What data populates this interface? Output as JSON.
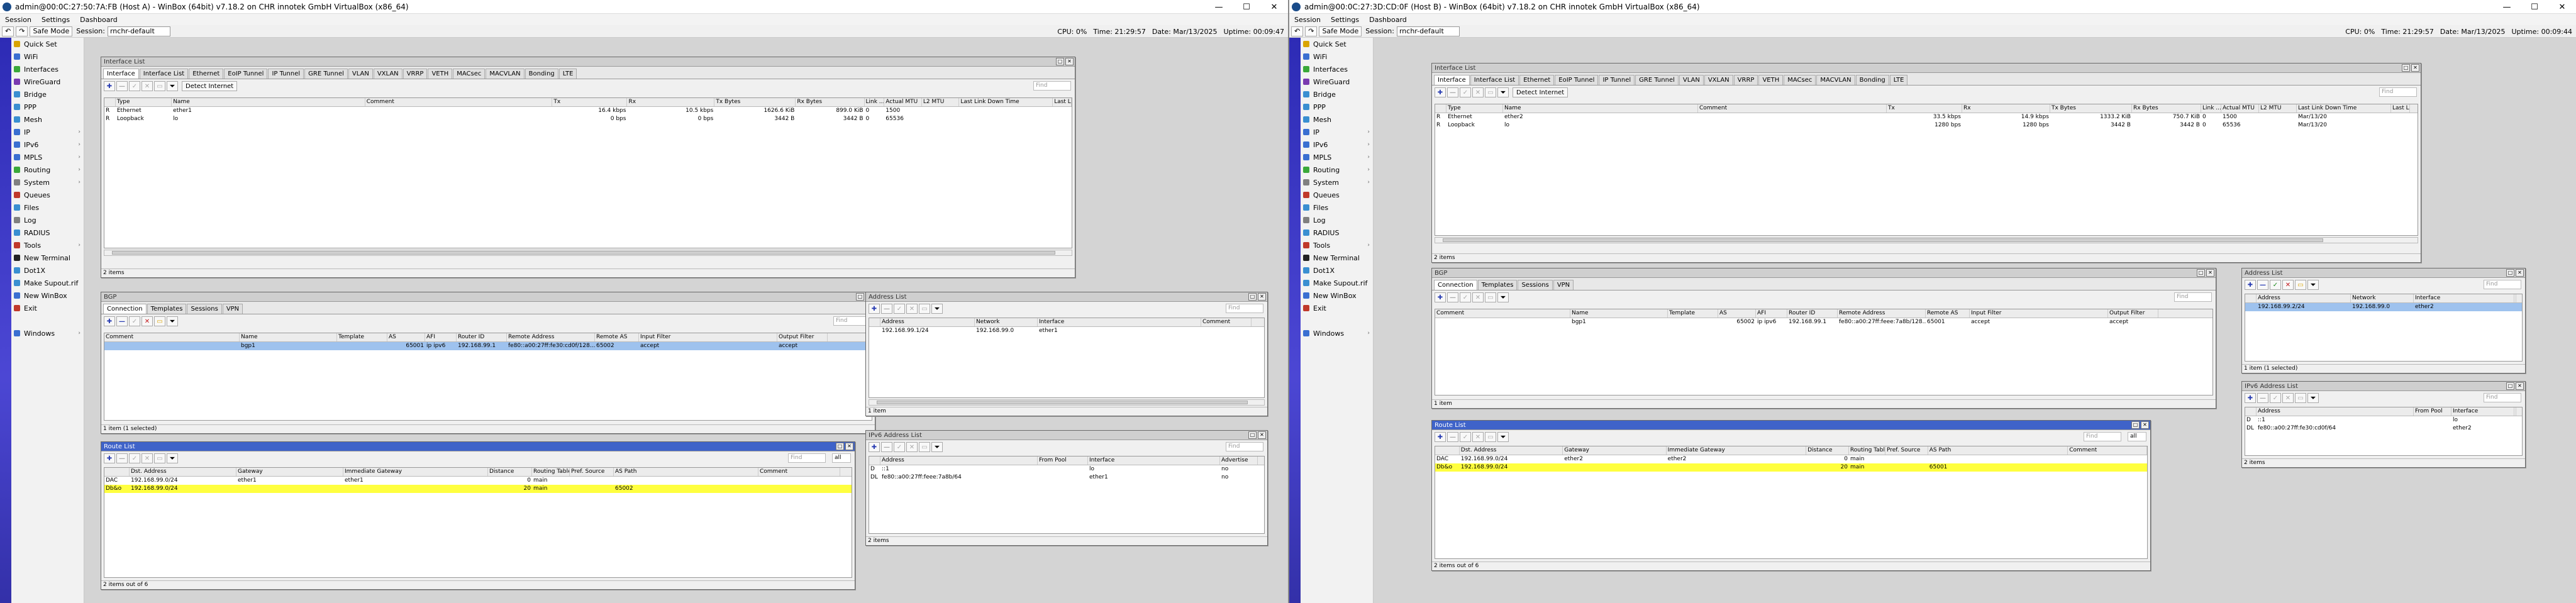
{
  "left": {
    "title": "admin@00:0C:27:50:7A:FB (Host A) - WinBox (64bit) v7.18.2 on CHR innotek GmbH VirtualBox (x86_64)",
    "uptime": "Uptime: 00:09:47",
    "time": "Time: 21:29:57",
    "date": "Date: Mar/13/2025",
    "interfaces": [
      {
        "flag": "R",
        "type": "Ethernet",
        "name": "ether1",
        "comment": "",
        "tx": "16.4 kbps",
        "rx": "1626.6 KiB",
        "rx2": "10.5 kbps",
        "txb": "1626.6 KiB",
        "rxb": "899.0 KiB",
        "link": "0",
        "amtu": "1500",
        "l2": "",
        "lldt": ""
      },
      {
        "flag": "R",
        "type": "Loopback",
        "name": "lo",
        "comment": "",
        "tx": "0 bps",
        "rx": "",
        "rx2": "0 bps",
        "txb": "3442 B",
        "rxb": "3442 B",
        "link": "0",
        "amtu": "65536",
        "l2": "",
        "lldt": ""
      }
    ],
    "bgp_rows": [
      {
        "comment": "",
        "name": "bgp1",
        "template": "",
        "as": "65001",
        "afi": "ip ipv6",
        "rid": "192.168.99.1",
        "raddr": "fe80::a00:27ff:fe30:cd0f/128...",
        "ras": "65002",
        "infilter": "accept",
        "outfilter": "accept"
      }
    ],
    "addr_rows": [
      {
        "flag": "",
        "addr": "192.168.99.1/24",
        "net": "192.168.99.0",
        "iface": "ether1"
      }
    ],
    "ipv6_rows": [
      {
        "flag": "D",
        "addr": "::1",
        "pool": "",
        "iface": "lo",
        "adv": "no"
      },
      {
        "flag": "DL",
        "addr": "fe80::a00:27ff:feee:7a8b/64",
        "pool": "",
        "iface": "ether1",
        "adv": "no"
      }
    ],
    "route_rows": [
      {
        "flag": "DAC",
        "dst": "192.168.99.0/24",
        "gw": "ether1",
        "igw": "ether1",
        "dist": "0",
        "rt": "main",
        "ps": "",
        "asp": "",
        "comment": ""
      },
      {
        "flag": "Db&o",
        "dst": "192.168.99.0/24",
        "gw": "",
        "igw": "",
        "dist": "20",
        "rt": "main",
        "ps": "",
        "asp": "65002",
        "comment": ""
      }
    ],
    "route_status": "2 items out of 6",
    "bgp_status": "1 item (1 selected)",
    "addr_status": "1 item",
    "ipv6_status": "2 items",
    "iface_status": "2 items"
  },
  "right": {
    "title": "admin@00:0C:27:3D:CD:0F (Host B) - WinBox (64bit) v7.18.2 on CHR innotek GmbH VirtualBox (x86_64)",
    "uptime": "Uptime: 00:09:44",
    "time": "Time: 21:29:57",
    "date": "Date: Mar/13/2025",
    "interfaces": [
      {
        "flag": "R",
        "type": "Ethernet",
        "name": "ether2",
        "comment": "",
        "tx": "33.5 kbps",
        "rx2": "14.9 kbps",
        "txb": "1333.2 KiB",
        "rxb": "750.7 KiB",
        "link": "0",
        "amtu": "1500",
        "l2": "",
        "lldt": "Mar/13/20"
      },
      {
        "flag": "R",
        "type": "Loopback",
        "name": "lo",
        "comment": "",
        "tx": "1280 bps",
        "rx2": "1280 bps",
        "txb": "3442 B",
        "rxb": "3442 B",
        "link": "0",
        "amtu": "65536",
        "l2": "",
        "lldt": "Mar/13/20"
      }
    ],
    "bgp_rows": [
      {
        "comment": "",
        "name": "bgp1",
        "template": "",
        "as": "65002",
        "afi": "ip ipv6",
        "rid": "192.168.99.1",
        "raddr": "fe80::a00:27ff:feee:7a8b/128...",
        "ras": "65001",
        "infilter": "accept",
        "outfilter": "accept"
      }
    ],
    "addr_rows": [
      {
        "flag": "",
        "addr": "192.168.99.2/24",
        "net": "192.168.99.0",
        "iface": "ether2"
      }
    ],
    "ipv6_rows": [
      {
        "flag": "D",
        "addr": "::1",
        "pool": "",
        "iface": "lo"
      },
      {
        "flag": "DL",
        "addr": "fe80::a00:27ff:fe30:cd0f/64",
        "pool": "",
        "iface": "ether2"
      }
    ],
    "route_rows": [
      {
        "flag": "DAC",
        "dst": "192.168.99.0/24",
        "gw": "ether2",
        "igw": "ether2",
        "dist": "0",
        "rt": "main",
        "ps": "",
        "asp": "",
        "comment": ""
      },
      {
        "flag": "Db&o",
        "dst": "192.168.99.0/24",
        "gw": "",
        "igw": "",
        "dist": "20",
        "rt": "main",
        "ps": "",
        "asp": "65001",
        "comment": ""
      }
    ],
    "route_status": "2 items out of 6",
    "bgp_status": "1 item",
    "addr_status": "1 item (1 selected)",
    "ipv6_status": "2 items",
    "iface_status": "2 items"
  },
  "common": {
    "menu": [
      "Session",
      "Settings",
      "Dashboard"
    ],
    "safe_mode": "Safe Mode",
    "session_label": "Session:",
    "session_value": "rnchr-default",
    "cpu": "CPU: 0%",
    "sidebar": [
      {
        "label": "Quick Set",
        "color": "#d9a400",
        "arrow": false
      },
      {
        "label": "WiFi",
        "color": "#3a6fd1",
        "arrow": false
      },
      {
        "label": "Interfaces",
        "color": "#3aa83a",
        "arrow": false
      },
      {
        "label": "WireGuard",
        "color": "#7a3ab0",
        "arrow": false
      },
      {
        "label": "Bridge",
        "color": "#3a8fd1",
        "arrow": false
      },
      {
        "label": "PPP",
        "color": "#3a8fd1",
        "arrow": false
      },
      {
        "label": "Mesh",
        "color": "#3a8fd1",
        "arrow": false
      },
      {
        "label": "IP",
        "color": "#3a6fd1",
        "arrow": true
      },
      {
        "label": "IPv6",
        "color": "#3a6fd1",
        "arrow": true
      },
      {
        "label": "MPLS",
        "color": "#3a6fd1",
        "arrow": true
      },
      {
        "label": "Routing",
        "color": "#3aa83a",
        "arrow": true
      },
      {
        "label": "System",
        "color": "#808080",
        "arrow": true
      },
      {
        "label": "Queues",
        "color": "#c0392b",
        "arrow": false
      },
      {
        "label": "Files",
        "color": "#3a8fd1",
        "arrow": false
      },
      {
        "label": "Log",
        "color": "#808080",
        "arrow": false
      },
      {
        "label": "RADIUS",
        "color": "#3a8fd1",
        "arrow": false
      },
      {
        "label": "Tools",
        "color": "#c0392b",
        "arrow": true
      },
      {
        "label": "New Terminal",
        "color": "#222222",
        "arrow": false
      },
      {
        "label": "Dot1X",
        "color": "#3a8fd1",
        "arrow": false
      },
      {
        "label": "Make Supout.rif",
        "color": "#3a8fd1",
        "arrow": false
      },
      {
        "label": "New WinBox",
        "color": "#3a6fd1",
        "arrow": false
      },
      {
        "label": "Exit",
        "color": "#c0392b",
        "arrow": false
      },
      {
        "label": "",
        "color": "",
        "arrow": false
      },
      {
        "label": "Windows",
        "color": "#3a6fd1",
        "arrow": true
      }
    ],
    "iface_win_title": "Interface List",
    "iface_tabs": [
      "Interface",
      "Interface List",
      "Ethernet",
      "EoIP Tunnel",
      "IP Tunnel",
      "GRE Tunnel",
      "VLAN",
      "VXLAN",
      "VRRP",
      "VETH",
      "MACsec",
      "MACVLAN",
      "Bonding",
      "LTE"
    ],
    "detect_internet": "Detect Internet",
    "find": "Find",
    "iface_cols": [
      "",
      "Type",
      "Name",
      "Comment",
      "Tx",
      "Rx",
      "Tx Bytes",
      "Rx Bytes",
      "Link ...",
      "Actual MTU",
      "L2 MTU",
      "Last Link Down Time",
      "Last Link"
    ],
    "bgp_win_title": "BGP",
    "bgp_tabs": [
      "Connection",
      "Templates",
      "Sessions",
      "VPN"
    ],
    "bgp_cols": [
      "Comment",
      "Name",
      "Template",
      "AS",
      "AFI",
      "Router ID",
      "Remote Address",
      "Remote AS",
      "Input Filter",
      "Output Filter"
    ],
    "addr_win_title": "Address List",
    "addr_cols": [
      "",
      "Address",
      "Network",
      "Interface",
      "Comment"
    ],
    "ipv6_win_title": "IPv6 Address List",
    "ipv6_cols": [
      "",
      "Address",
      "From Pool",
      "Interface",
      "Advertise"
    ],
    "route_win_title": "Route List",
    "route_cols": [
      "",
      "Dst. Address",
      "Gateway",
      "Immediate Gateway",
      "Distance",
      "Routing Table",
      "Pref. Source",
      "AS Path",
      "Comment"
    ],
    "all": "all"
  }
}
